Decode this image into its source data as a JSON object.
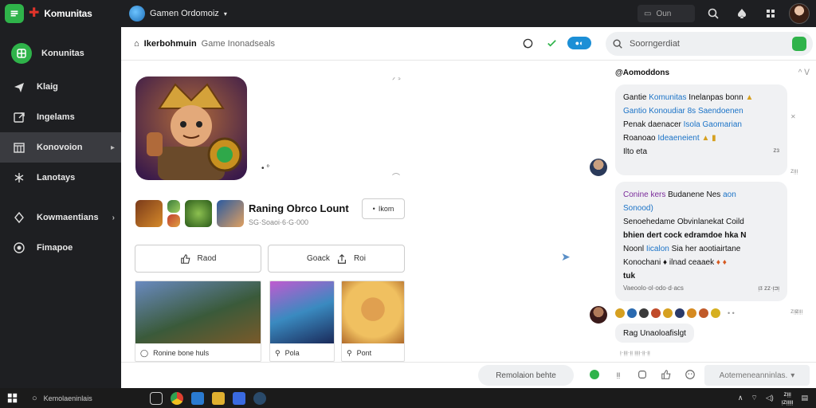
{
  "topbar": {
    "brand": "Komunitas",
    "server": "Gamen Ordomoiz",
    "search_label": "Oun"
  },
  "sidebar": {
    "brand_label": "Konunitas",
    "items": [
      {
        "label": "Klaig",
        "icon": "send-icon"
      },
      {
        "label": "Ingelams",
        "icon": "export-icon"
      },
      {
        "label": "Konovoion",
        "icon": "calendar-icon"
      },
      {
        "label": "Lanotays",
        "icon": "star-icon"
      },
      {
        "label": "Kowmaentians",
        "icon": "compass-icon"
      },
      {
        "label": "Fimapoe",
        "icon": "globe-icon"
      }
    ]
  },
  "main": {
    "crumb_bold": "Ikerbohmuin",
    "crumb_light": "Game Inonadseals",
    "search_placeholder": "Soorngerdiat",
    "game_title": "Raning Obrco Lount",
    "game_sub": "SG·Soaoi·6·G·000",
    "follow_label": "Ikom",
    "action_left": "Raod",
    "action_right_a": "Goack",
    "action_right_b": "Roi",
    "cards": [
      {
        "caption": "Ronine bone huls"
      },
      {
        "caption": "Pola"
      },
      {
        "caption": "Pont"
      }
    ],
    "scribble_1": "ᐟ ᐣ",
    "scribble_2": "⌒",
    "page_dots": "• °"
  },
  "chat": {
    "header": "@Aomoddons",
    "header_meta": "^ ᐯ",
    "msg1": {
      "line1_a": "Gantie",
      "line1_b": "Komunitas",
      "line1_c": "Inelanpas bonn",
      "line2": "Gantio Konoudiar 8s Saendoenen",
      "line3_a": "Penak daenacer",
      "line3_b": "Isola Gaomarian",
      "line4_a": "Roanoao",
      "line4_b": "Ideaeneient",
      "meta_left": "Ilto eta",
      "meta_right": "ᴢɜ"
    },
    "msg2": {
      "line1_a": "Conine kers",
      "line1_b": "Budanene Nes",
      "line1_c": "aon",
      "line2": "Sonood)",
      "line3": "Senoehedame Obvinlanekat Coild",
      "line4": "bhien dert cock edramdoe hka N",
      "line5_a": "Noonl",
      "line5_b": "Iicalon",
      "line5_c": "Sia her aootiairtane",
      "line6": "Konochani ♦ ilnad ceaaek",
      "line7": "tuk",
      "meta_left": "Vaeoolo·ol·odo·d·acs",
      "meta_right": "ᴉᴣ ᴢᴢ·ᴉᴝᴉ"
    },
    "reply": "Rag Unaoloafislgt",
    "read_line": "ᴉ·ᴉᴉᴉ·ᴉᴉ ᴉᴉᴉᴉ·ᴉᴉ·ᴉᴉ",
    "side_marks": [
      "ᴢᴉᴉᴉ",
      "ᴢᴉᴉᴉ",
      "ᴢᴉᴉᴉ"
    ]
  },
  "composer": {
    "pill_label": "Remolaion behte",
    "counter": "ᴉᴉ",
    "send_label": "Aotemeneanninlas."
  },
  "taskbar": {
    "search": "Kemolaeninlais",
    "clock_time": "ᴢᴉᴉᴉ",
    "clock_date": "ᴉᴢᴉᴉᴉᴉᴉ"
  },
  "colors": {
    "brand_green": "#2fb34a",
    "accent_blue": "#1b73c7",
    "sidebar_bg": "#1e1f22"
  }
}
